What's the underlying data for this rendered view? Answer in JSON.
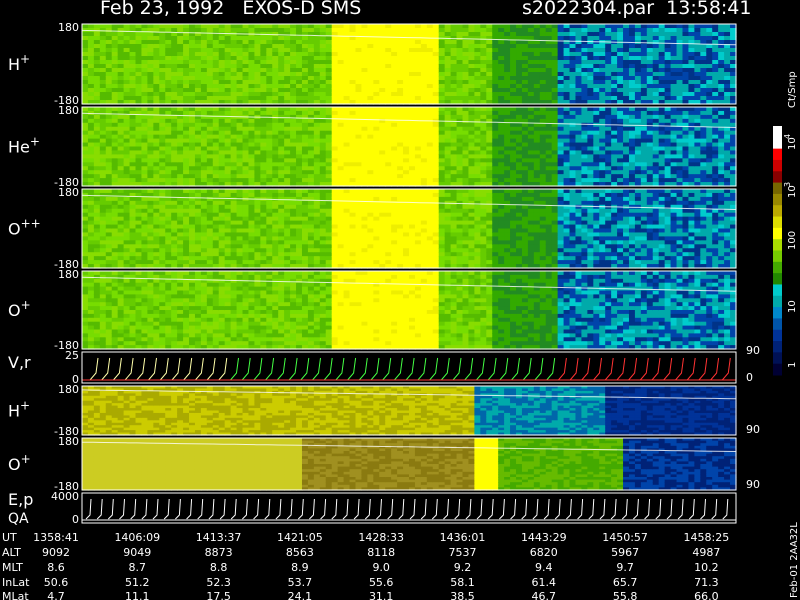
{
  "header": {
    "title": "Feb 23, 1992   EXOS-D SMS",
    "file": "s2022304.par  13:58:41"
  },
  "chart_data": {
    "type": "heatmap",
    "panels": [
      {
        "label": "H",
        "sup": "+",
        "ymin": "-180",
        "ymax": "180",
        "kind": "spectro",
        "yellow_band": [
          0.38,
          0.54
        ]
      },
      {
        "label": "He",
        "sup": "+",
        "ymin": "-180",
        "ymax": "180",
        "kind": "spectro",
        "yellow_band": [
          0.38,
          0.54
        ]
      },
      {
        "label": "O",
        "sup": "++",
        "ymin": "-180",
        "ymax": "180",
        "kind": "spectro",
        "yellow_band": [
          0.38,
          0.54
        ]
      },
      {
        "label": "O",
        "sup": "+",
        "ymin": "-180",
        "ymax": "180",
        "kind": "spectro",
        "yellow_band": [
          0.38,
          0.54
        ]
      },
      {
        "label": "V,r",
        "sup": "",
        "ymin": "0",
        "ymax": "25",
        "kind": "line",
        "right_max": "90",
        "right_min": "0"
      },
      {
        "label": "H",
        "sup": "+",
        "ymin": "-180",
        "ymax": "180",
        "kind": "spectro2",
        "right_min": "90"
      },
      {
        "label": "O",
        "sup": "+",
        "ymin": "-180",
        "ymax": "180",
        "kind": "spectro3",
        "right_min": "90"
      },
      {
        "label": "E,p",
        "label2": "QA",
        "sup": "",
        "ymin": "0",
        "ymax": "4000",
        "kind": "energy"
      }
    ],
    "colorbar": {
      "title": "Ct/Smp",
      "tick_labels": [
        "10",
        "4",
        "10",
        "3",
        "100",
        "10",
        "1"
      ],
      "tick_values": [
        10000,
        1000,
        100,
        10,
        1
      ]
    },
    "orbit_table": {
      "row_labels": [
        "UT",
        "ALT",
        "MLT",
        "InLat",
        "MLat"
      ],
      "columns": [
        {
          "UT": "1358:41",
          "ALT": "9092",
          "MLT": "8.6",
          "InLat": "50.6",
          "MLat": "4.7"
        },
        {
          "UT": "1406:09",
          "ALT": "9049",
          "MLT": "8.7",
          "InLat": "51.2",
          "MLat": "11.1"
        },
        {
          "UT": "1413:37",
          "ALT": "8873",
          "MLT": "8.8",
          "InLat": "52.3",
          "MLat": "17.5"
        },
        {
          "UT": "1421:05",
          "ALT": "8563",
          "MLT": "8.9",
          "InLat": "53.7",
          "MLat": "24.1"
        },
        {
          "UT": "1428:33",
          "ALT": "8118",
          "MLT": "9.0",
          "InLat": "55.6",
          "MLat": "31.1"
        },
        {
          "UT": "1436:01",
          "ALT": "7537",
          "MLT": "9.2",
          "InLat": "58.1",
          "MLat": "38.5"
        },
        {
          "UT": "1443:29",
          "ALT": "6820",
          "MLT": "9.4",
          "InLat": "61.4",
          "MLat": "46.7"
        },
        {
          "UT": "1450:57",
          "ALT": "5967",
          "MLT": "9.7",
          "InLat": "65.7",
          "MLat": "55.8"
        },
        {
          "UT": "1458:25",
          "ALT": "4987",
          "MLT": "10.2",
          "InLat": "71.3",
          "MLat": "66.0"
        }
      ]
    },
    "side_label": "Feb-01 2AA32L"
  }
}
